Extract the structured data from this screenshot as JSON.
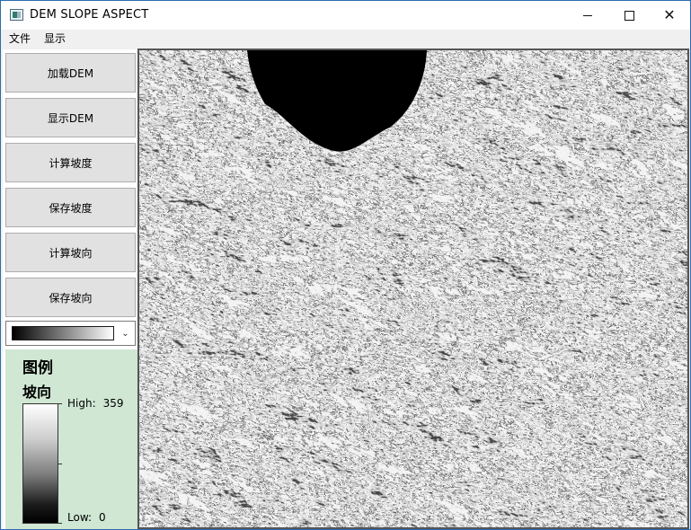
{
  "window": {
    "title": "DEM SLOPE ASPECT",
    "controls": [
      "minimize",
      "maximize",
      "close"
    ]
  },
  "menu": {
    "file": "文件",
    "view": "显示"
  },
  "buttons": {
    "load_dem": "加载DEM",
    "show_dem": "显示DEM",
    "calc_slope": "计算坡度",
    "save_slope": "保存坡度",
    "calc_aspect": "计算坡向",
    "save_aspect": "保存坡向"
  },
  "color_ramp_select": {
    "selected": "black-to-white gradient"
  },
  "legend": {
    "title": "图例",
    "layer": "坡向",
    "high_label": "High:",
    "high_value": "359",
    "low_label": "Low:",
    "low_value": "0"
  },
  "colors": {
    "legend_bg": "#cfe7d3",
    "button_bg": "#e1e1e1",
    "title_border": "#2b6cb0"
  },
  "icons": {
    "app": "app-window-icon",
    "minimize": "minimize-icon",
    "maximize": "maximize-icon",
    "close": "close-icon",
    "dropdown": "chevron-down-icon"
  }
}
